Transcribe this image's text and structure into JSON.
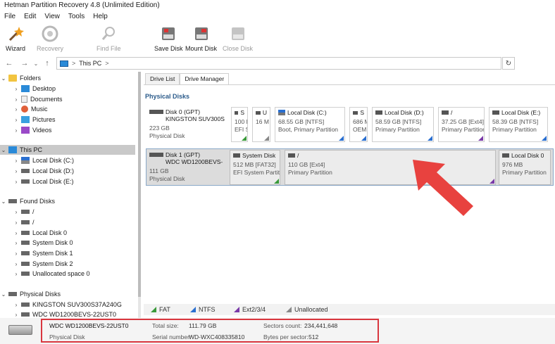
{
  "window": {
    "title": "Hetman Partition Recovery 4.8 (Unlimited Edition)"
  },
  "menu": [
    "File",
    "Edit",
    "View",
    "Tools",
    "Help"
  ],
  "toolbar": {
    "wizard": "Wizard",
    "recovery": "Recovery",
    "find_file": "Find File",
    "save_disk": "Save Disk",
    "mount_disk": "Mount Disk",
    "close_disk": "Close Disk"
  },
  "address": {
    "path": "This PC",
    "separator": ">"
  },
  "tree": {
    "folders": "Folders",
    "folder_items": [
      "Desktop",
      "Documents",
      "Music",
      "Pictures",
      "Videos"
    ],
    "this_pc": "This PC",
    "pc_items": [
      "Local Disk (C:)",
      "Local Disk (D:)",
      "Local Disk (E:)"
    ],
    "found_disks": "Found Disks",
    "found_items": [
      "/",
      "/",
      "Local Disk 0",
      "System Disk 0",
      "System Disk 1",
      "System Disk 2",
      "Unallocated space 0"
    ],
    "physical_disks": "Physical Disks",
    "physical_items": [
      "KINGSTON SUV300S37A240G",
      "WDC WD1200BEVS-22UST0"
    ]
  },
  "tabs": [
    "Drive List",
    "Drive Manager"
  ],
  "section": {
    "title": "Physical Disks"
  },
  "disk0": {
    "name": "Disk 0 (GPT)",
    "model": "KINGSTON SUV300S",
    "size": "223 GB",
    "type": "Physical Disk",
    "parts": [
      {
        "name": "S",
        "size": "100 M",
        "info": "EFI S"
      },
      {
        "name": "U",
        "size": "16 M",
        "info": ""
      },
      {
        "name": "Local Disk (C:)",
        "size": "68.55 GB [NTFS]",
        "info": "Boot, Primary Partition"
      },
      {
        "name": "S",
        "size": "686 M",
        "info": "OEM"
      },
      {
        "name": "Local Disk (D:)",
        "size": "58.59 GB [NTFS]",
        "info": "Primary Partition"
      },
      {
        "name": "/",
        "size": "37.25 GB [Ext4]",
        "info": "Primary Partition"
      },
      {
        "name": "Local Disk (E:)",
        "size": "58.39 GB [NTFS]",
        "info": "Primary Partition"
      }
    ]
  },
  "disk1": {
    "name": "Disk 1 (GPT)",
    "model": "WDC WD1200BEVS-",
    "size": "111 GB",
    "type": "Physical Disk",
    "parts": [
      {
        "name": "System Disk",
        "size": "512 MB [FAT32]",
        "info": "EFI System Partit"
      },
      {
        "name": "/",
        "size": "110 GB [Ext4]",
        "info": "Primary Partition"
      },
      {
        "name": "Local Disk 0",
        "size": "976 MB",
        "info": "Primary Partition"
      }
    ]
  },
  "legend": [
    {
      "label": "FAT",
      "color": "#3a9a3a"
    },
    {
      "label": "NTFS",
      "color": "#2a6fd0"
    },
    {
      "label": "Ext2/3/4",
      "color": "#7a3aa8"
    },
    {
      "label": "Unallocated",
      "color": "#888888"
    }
  ],
  "status": {
    "model": "WDC WD1200BEVS-22UST0",
    "type": "Physical Disk",
    "total_size_label": "Total size:",
    "total_size": "111.79 GB",
    "serial_label": "Serial number:",
    "serial": "WD-WXC408335810",
    "sectors_label": "Sectors count:",
    "sectors": "234,441,648",
    "bps_label": "Bytes per sector:",
    "bps": "512"
  },
  "colors": {
    "highlight": "#d9363e",
    "arrow": "#e8423f",
    "section": "#2a5a8a"
  }
}
